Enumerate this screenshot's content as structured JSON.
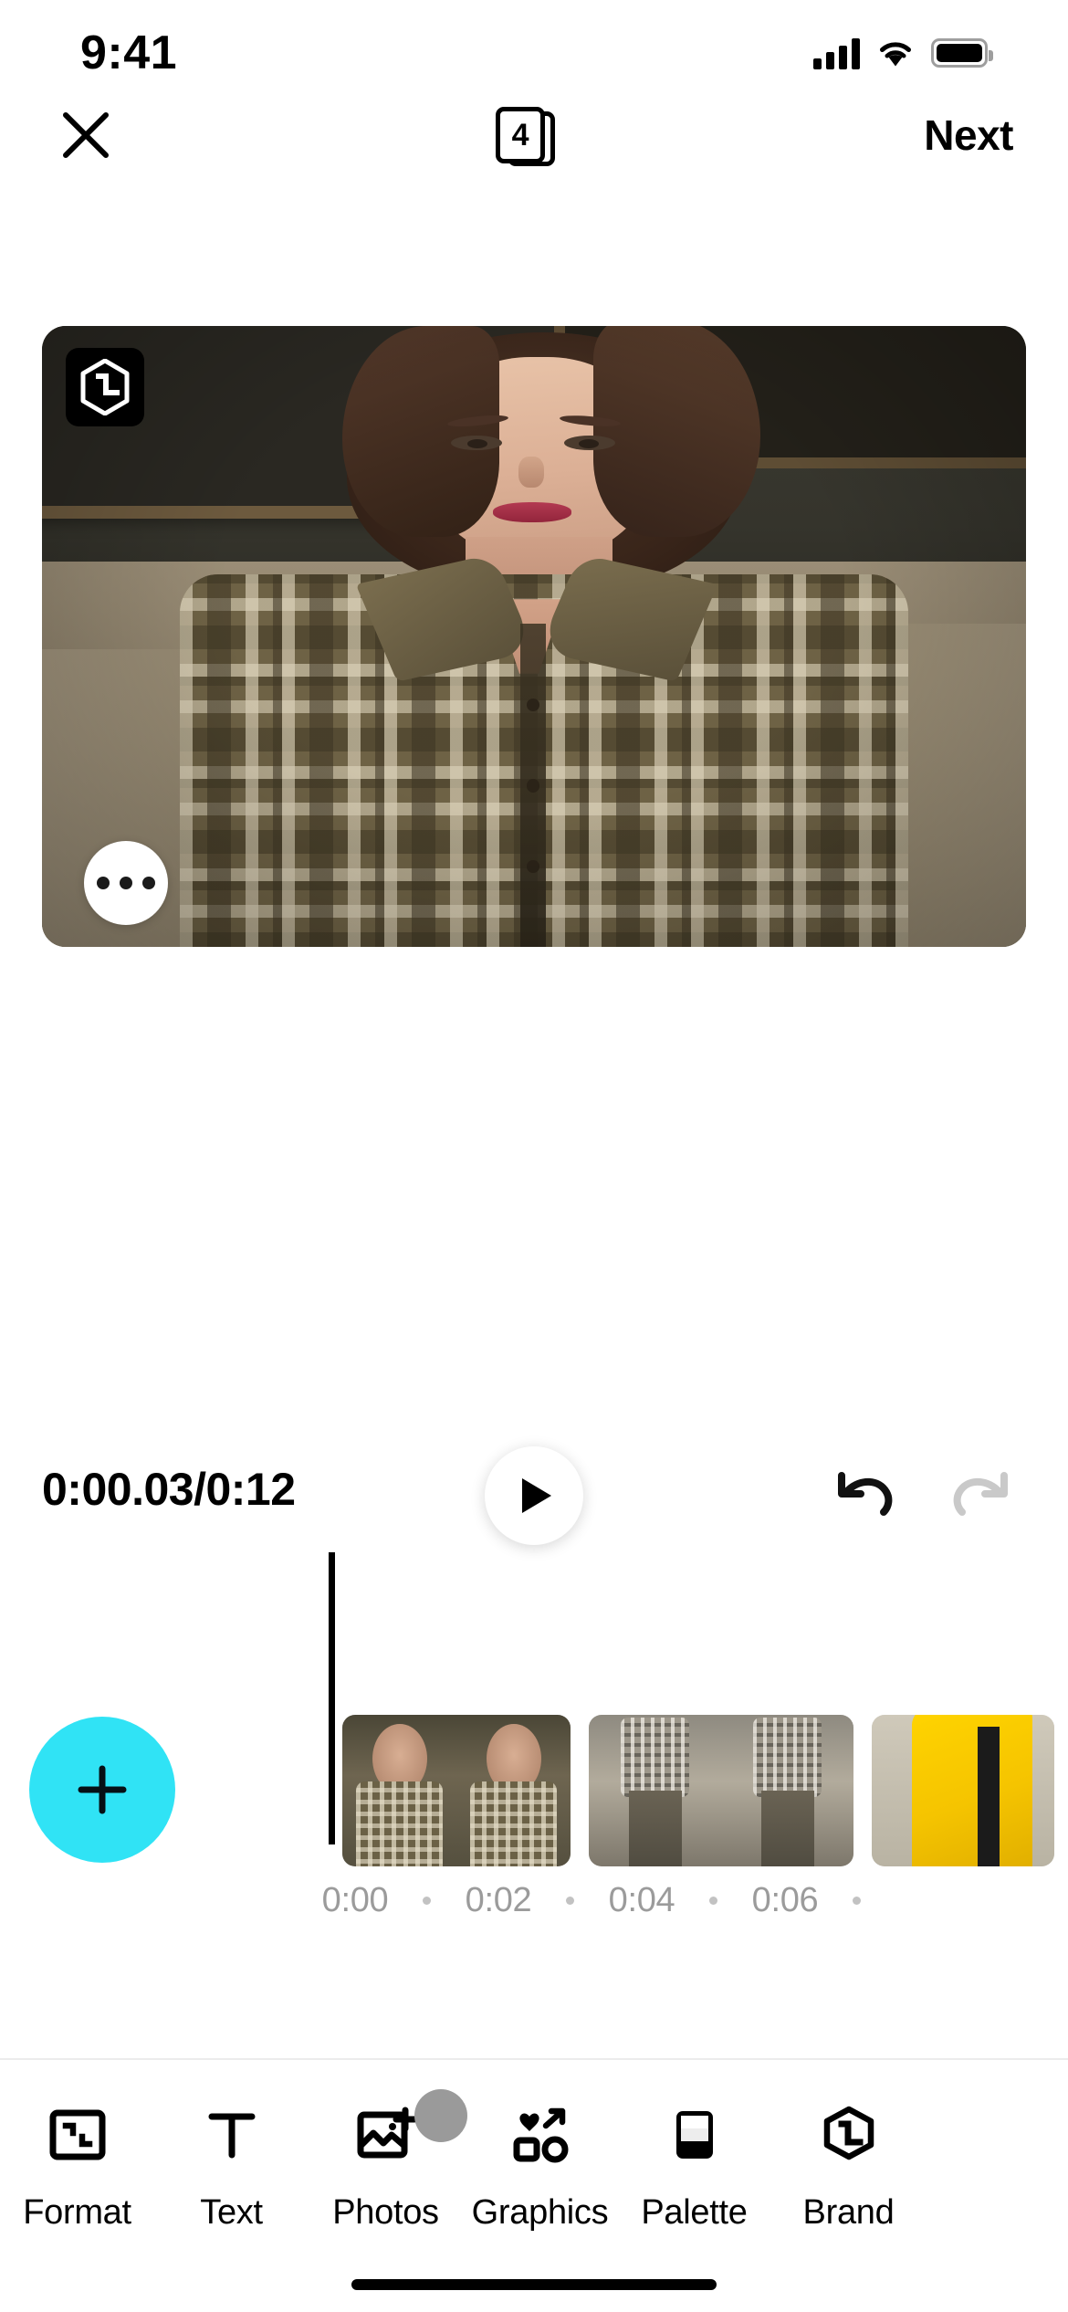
{
  "status_bar": {
    "time": "9:41",
    "cellular_icon": "cellular-signal-icon",
    "wifi_icon": "wifi-icon",
    "battery_icon": "battery-icon"
  },
  "nav_bar": {
    "close_icon": "close-x-icon",
    "pages_badge_count": "4",
    "pages_badge_icon": "stacked-pages-icon",
    "next_label": "Next"
  },
  "preview": {
    "watermark_logo": "hexagon-l-logo-icon",
    "watermark_letter": "L",
    "more_options_icon": "more-dots-icon"
  },
  "playback": {
    "timecode": "0:00.03/0:12",
    "current_time": "0:00.03",
    "total_time": "0:12",
    "play_icon": "play-icon",
    "undo_icon": "undo-icon",
    "redo_icon": "redo-icon",
    "redo_enabled": "false"
  },
  "timeline": {
    "add_clip_icon": "plus-icon",
    "playhead_position_label": "0:00.03",
    "clips": [
      {
        "name": "clip-1",
        "thumbs": 2
      },
      {
        "name": "clip-2",
        "thumbs": 2
      },
      {
        "name": "clip-3",
        "thumbs": 1
      }
    ],
    "ruler_ticks": [
      "0:00",
      "0:02",
      "0:04",
      "0:06"
    ]
  },
  "toolbar": {
    "items": [
      {
        "label": "Format",
        "icon": "format-frame-icon",
        "badge": false
      },
      {
        "label": "Text",
        "icon": "text-t-icon",
        "badge": false
      },
      {
        "label": "Photos",
        "icon": "photo-add-icon",
        "badge": true
      },
      {
        "label": "Graphics",
        "icon": "graphics-shapes-icon",
        "badge": false
      },
      {
        "label": "Palette",
        "icon": "palette-card-icon",
        "badge": false
      },
      {
        "label": "Brand",
        "icon": "hexagon-l-logo-icon",
        "badge": false
      }
    ]
  },
  "colors": {
    "accent_cyan": "#30E3F5",
    "badge_gray": "#9A9A9A",
    "ruler_text": "#9B9B9B"
  }
}
